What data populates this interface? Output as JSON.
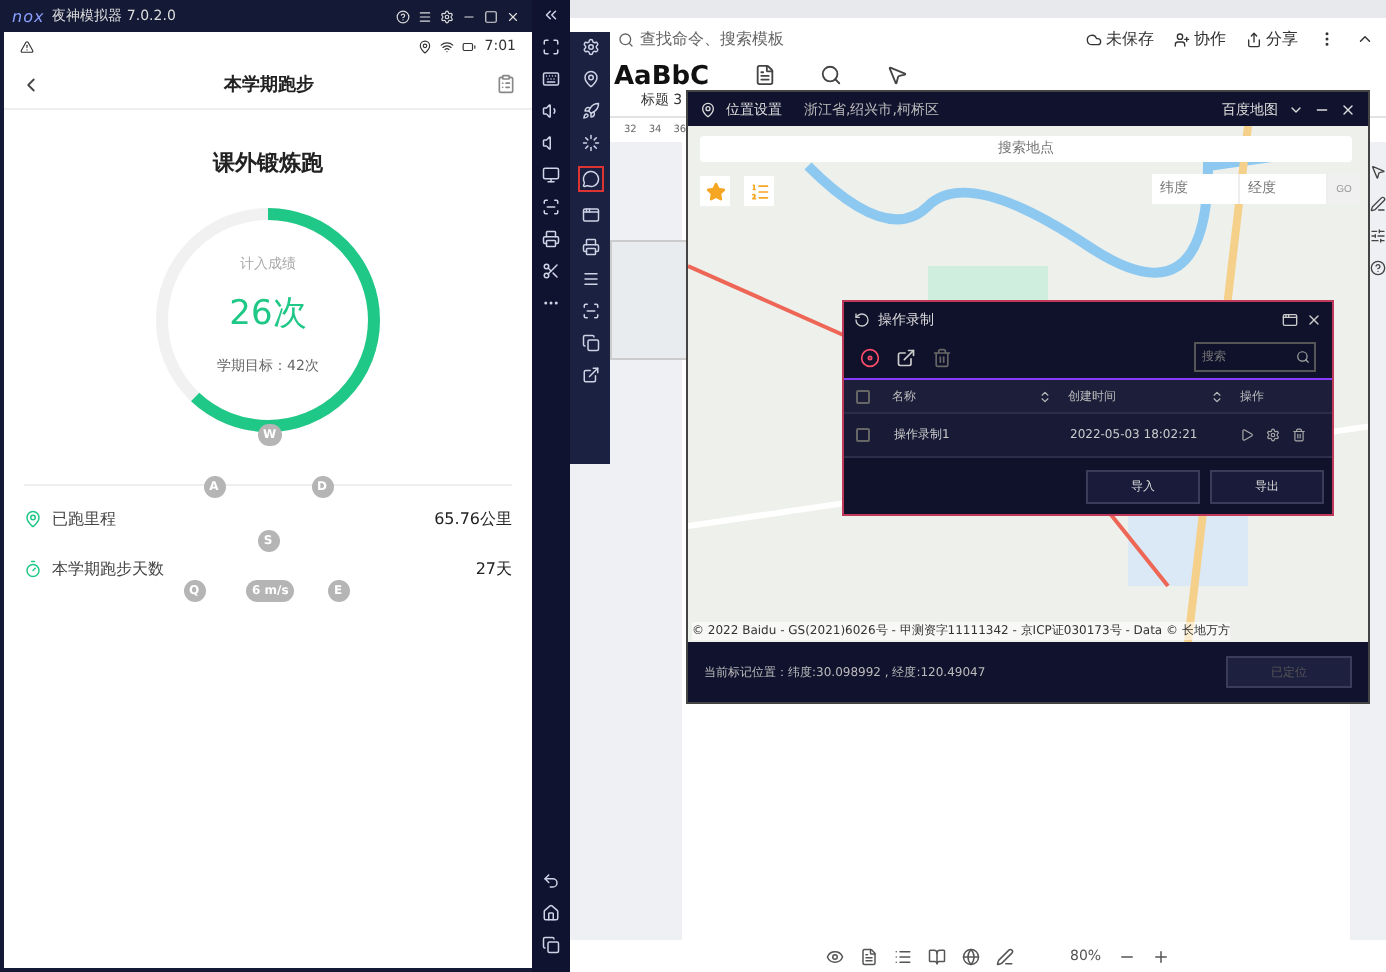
{
  "emulator": {
    "logo": "nox",
    "title": "夜神模拟器 7.0.2.0"
  },
  "phone": {
    "status_time": "7:01",
    "header_title": "本学期跑步",
    "card_title": "课外锻炼跑",
    "ring": {
      "caption": "计入成绩",
      "count": "26次",
      "goal": "学期目标：42次",
      "level": 0.62
    },
    "key_overlay": [
      "W",
      "A",
      "D",
      "S",
      "Q",
      "6 m/s",
      "E"
    ],
    "stats": [
      {
        "kind": "distance",
        "label": "已跑里程",
        "value": "65.76公里"
      },
      {
        "kind": "days",
        "label": "本学期跑步天数",
        "value": "27天"
      }
    ]
  },
  "editor": {
    "search": {
      "placeholder": "查找命令、搜索模板"
    },
    "actions": [
      "未保存",
      "协作",
      "分享"
    ],
    "style_preview": "AaBbC",
    "style_name": "标题 3",
    "ruler": [
      "32",
      "34",
      "36"
    ],
    "zoom": "80%"
  },
  "location_window": {
    "title": "位置设置",
    "region": "浙江省,绍兴市,柯桥区",
    "map_source": "百度地图",
    "search": {
      "placeholder": "搜索地点"
    },
    "latitude": {
      "placeholder": "纬度"
    },
    "longitude": {
      "placeholder": "经度"
    },
    "go": "GO",
    "copyright": "© 2022 Baidu - GS(2021)6026号 - 甲测资字11111342 - 京ICP证030173号 - Data © 长地万方",
    "current_position": "当前标记位置：纬度:30.098992 , 经度:120.49047",
    "locate_button": {
      "label": "已定位",
      "disabled": true
    }
  },
  "recorder": {
    "title": "操作录制",
    "search": {
      "placeholder": "搜索"
    },
    "all_checked": false,
    "columns": [
      "名称",
      "创建时间",
      "操作"
    ],
    "rows": [
      {
        "name": "操作录制1",
        "created": "2022-05-03 18:02:21",
        "checked": false
      }
    ],
    "buttons": [
      "导入",
      "导出"
    ]
  }
}
